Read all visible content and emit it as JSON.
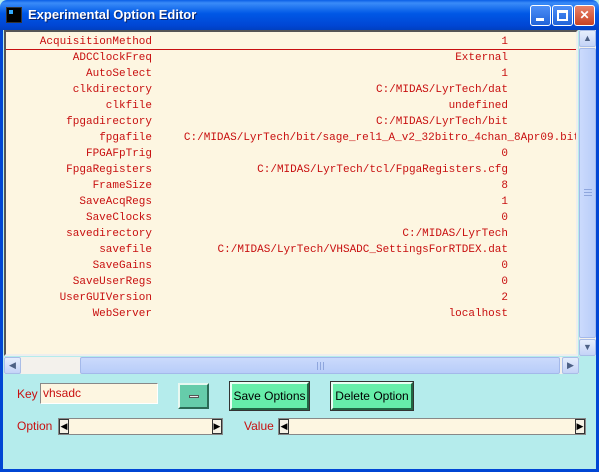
{
  "window": {
    "title": "Experimental Option Editor",
    "controls": {
      "minimize": "",
      "maximize": "",
      "close": "✕"
    }
  },
  "options": [
    {
      "key": "AcquisitionMethod",
      "value": "1",
      "selected": true
    },
    {
      "key": "ADCClockFreq",
      "value": "External"
    },
    {
      "key": "AutoSelect",
      "value": "1"
    },
    {
      "key": "clkdirectory",
      "value": "C:/MIDAS/LyrTech/dat"
    },
    {
      "key": "clkfile",
      "value": "undefined"
    },
    {
      "key": "fpgadirectory",
      "value": "C:/MIDAS/LyrTech/bit"
    },
    {
      "key": "fpgafile",
      "value": "C:/MIDAS/LyrTech/bit/sage_rel1_A_v2_32bitro_4chan_8Apr09.bit",
      "wide": true
    },
    {
      "key": "FPGAFpTrig",
      "value": "0"
    },
    {
      "key": "FpgaRegisters",
      "value": "C:/MIDAS/LyrTech/tcl/FpgaRegisters.cfg"
    },
    {
      "key": "FrameSize",
      "value": "8"
    },
    {
      "key": "SaveAcqRegs",
      "value": "1"
    },
    {
      "key": "SaveClocks",
      "value": "0"
    },
    {
      "key": "savedirectory",
      "value": "C:/MIDAS/LyrTech"
    },
    {
      "key": "savefile",
      "value": "C:/MIDAS/LyrTech/VHSADC_SettingsForRTDEX.dat"
    },
    {
      "key": "SaveGains",
      "value": "0"
    },
    {
      "key": "SaveUserRegs",
      "value": "0"
    },
    {
      "key": "UserGUIVersion",
      "value": "2"
    },
    {
      "key": "WebServer",
      "value": "localhost"
    }
  ],
  "form": {
    "key_label": "Key",
    "key_value": "vhsadc",
    "save_label": "Save Options",
    "delete_label": "Delete Option",
    "option_label": "Option",
    "option_value": "",
    "value_label": "Value",
    "value_value": ""
  },
  "scroll": {
    "up": "▲",
    "down": "▼",
    "left": "◀",
    "right": "▶"
  },
  "colors": {
    "accent_text": "#c81010",
    "background": "#b5ecec",
    "list_background": "#fdf6e1",
    "button_green": "#66eeaa"
  }
}
